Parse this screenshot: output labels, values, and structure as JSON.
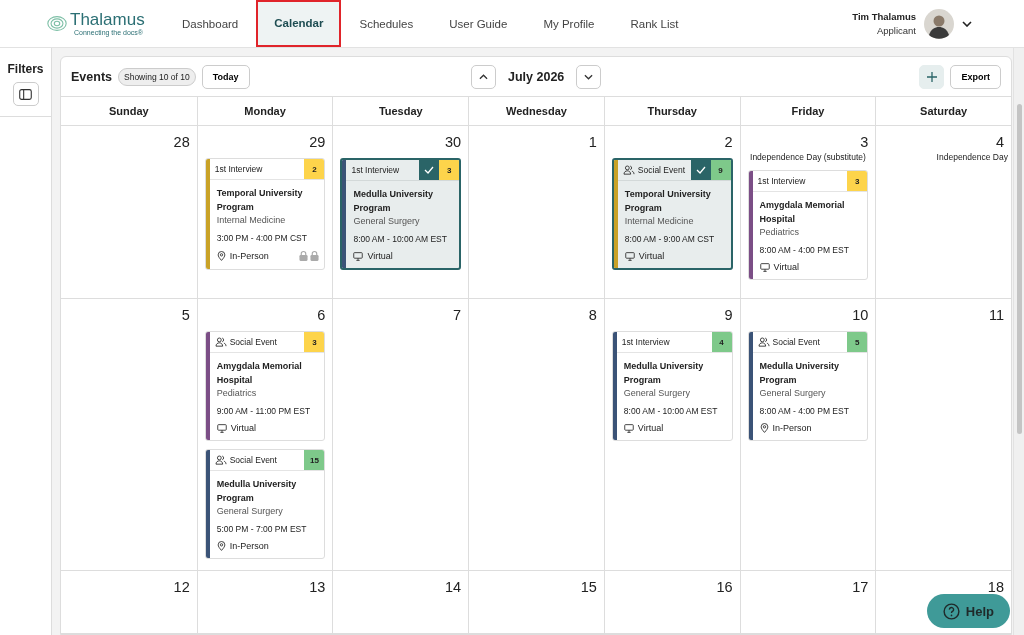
{
  "header": {
    "logo": {
      "name": "Thalamus",
      "tagline": "Connecting the docs®"
    },
    "nav": [
      {
        "label": "Dashboard",
        "selected": false
      },
      {
        "label": "Calendar",
        "selected": true
      },
      {
        "label": "Schedules",
        "selected": false
      },
      {
        "label": "User Guide",
        "selected": false
      },
      {
        "label": "My Profile",
        "selected": false
      },
      {
        "label": "Rank List",
        "selected": false
      }
    ],
    "user": {
      "name": "Tim Thalamus",
      "role": "Applicant"
    }
  },
  "sidebar": {
    "title": "Filters"
  },
  "toolbar": {
    "title": "Events",
    "count": "Showing 10 of 10",
    "today": "Today",
    "month": "July 2026",
    "export": "Export"
  },
  "weekdays": [
    "Sunday",
    "Monday",
    "Tuesday",
    "Wednesday",
    "Thursday",
    "Friday",
    "Saturday"
  ],
  "weeks": [
    [
      {
        "day": "28"
      },
      {
        "day": "29",
        "events": [
          {
            "kind": "interview",
            "label": "1st Interview",
            "count": {
              "text": "2",
              "color": "#fdd44b"
            },
            "color": "#c9a227",
            "selected": false,
            "title": "Temporal University Program",
            "specialty": "Internal Medicine",
            "time": "3:00 PM - 4:00 PM CST",
            "mode": {
              "kind": "in-person",
              "label": "In-Person"
            },
            "locked": true
          }
        ]
      },
      {
        "day": "30",
        "events": [
          {
            "kind": "interview",
            "label": "1st Interview",
            "count": {
              "text": "3",
              "color": "#fdd44b"
            },
            "color": "#3b5377",
            "selected": true,
            "title": "Medulla University Program",
            "specialty": "General Surgery",
            "time": "8:00 AM - 10:00 AM EST",
            "mode": {
              "kind": "virtual",
              "label": "Virtual"
            },
            "locked": false
          }
        ]
      },
      {
        "day": "1"
      },
      {
        "day": "2",
        "events": [
          {
            "kind": "social",
            "label": "Social Event",
            "count": {
              "text": "9",
              "color": "#7ec98a"
            },
            "color": "#c9a227",
            "selected": true,
            "title": "Temporal University Program",
            "specialty": "Internal Medicine",
            "time": "8:00 AM - 9:00 AM CST",
            "mode": {
              "kind": "virtual",
              "label": "Virtual"
            },
            "locked": false
          }
        ]
      },
      {
        "day": "3",
        "holiday": "Independence Day (substitute)",
        "events": [
          {
            "kind": "interview",
            "label": "1st Interview",
            "count": {
              "text": "3",
              "color": "#fdd44b"
            },
            "color": "#7b4e86",
            "selected": false,
            "title": "Amygdala Memorial Hospital",
            "specialty": "Pediatrics",
            "time": "8:00 AM - 4:00 PM EST",
            "mode": {
              "kind": "virtual",
              "label": "Virtual"
            },
            "locked": false
          }
        ]
      },
      {
        "day": "4",
        "holiday": "Independence Day"
      }
    ],
    [
      {
        "day": "5"
      },
      {
        "day": "6",
        "events": [
          {
            "kind": "social",
            "label": "Social Event",
            "count": {
              "text": "3",
              "color": "#fdd44b"
            },
            "color": "#7b4e86",
            "selected": false,
            "title": "Amygdala Memorial Hospital",
            "specialty": "Pediatrics",
            "time": "9:00 AM - 11:00 PM EST",
            "mode": {
              "kind": "virtual",
              "label": "Virtual"
            },
            "locked": false
          },
          {
            "kind": "social",
            "label": "Social Event",
            "count": {
              "text": "15",
              "color": "#7ec98a"
            },
            "color": "#3b5377",
            "selected": false,
            "title": "Medulla University Program",
            "specialty": "General Surgery",
            "time": "5:00 PM - 7:00 PM EST",
            "mode": {
              "kind": "in-person",
              "label": "In-Person"
            },
            "locked": false
          }
        ]
      },
      {
        "day": "7"
      },
      {
        "day": "8"
      },
      {
        "day": "9",
        "events": [
          {
            "kind": "interview",
            "label": "1st Interview",
            "count": {
              "text": "4",
              "color": "#7ec98a"
            },
            "color": "#3b5377",
            "selected": false,
            "title": "Medulla University Program",
            "specialty": "General Surgery",
            "time": "8:00 AM - 10:00 AM EST",
            "mode": {
              "kind": "virtual",
              "label": "Virtual"
            },
            "locked": false
          }
        ]
      },
      {
        "day": "10",
        "events": [
          {
            "kind": "social",
            "label": "Social Event",
            "count": {
              "text": "5",
              "color": "#7ec98a"
            },
            "color": "#3b5377",
            "selected": false,
            "title": "Medulla University Program",
            "specialty": "General Surgery",
            "time": "8:00 AM - 4:00 PM EST",
            "mode": {
              "kind": "in-person",
              "label": "In-Person"
            },
            "locked": false
          }
        ]
      },
      {
        "day": "11"
      }
    ],
    [
      {
        "day": "12"
      },
      {
        "day": "13"
      },
      {
        "day": "14"
      },
      {
        "day": "15"
      },
      {
        "day": "16"
      },
      {
        "day": "17"
      },
      {
        "day": "18"
      }
    ]
  ],
  "help": "Help"
}
